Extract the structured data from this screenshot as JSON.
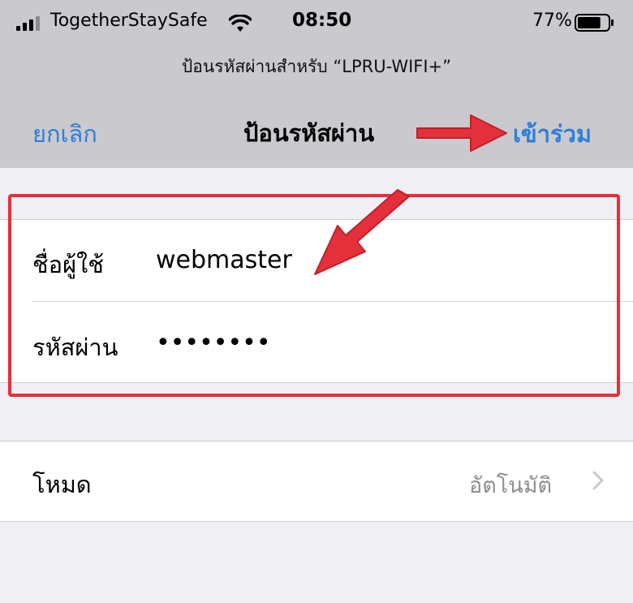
{
  "status_bar": {
    "carrier": "TogetherStaySafe",
    "time": "08:50",
    "battery_percent": "77%",
    "battery_level": 0.77,
    "signal_icon": "signal-bars-icon",
    "wifi_icon": "wifi-icon",
    "battery_icon": "battery-icon"
  },
  "dialog": {
    "prompt": "ป้อนรหัสผ่านสำหรับ “LPRU-WIFI+”",
    "cancel_label": "ยกเลิก",
    "title": "ป้อนรหัสผ่าน",
    "join_label": "เข้าร่วม"
  },
  "form": {
    "username_label": "ชื่อผู้ใช้",
    "username_value": "webmaster",
    "password_label": "รหัสผ่าน",
    "password_value": "••••••••"
  },
  "mode": {
    "label": "โหมด",
    "value": "อัตโนมัติ",
    "chevron_icon": "chevron-right-icon"
  },
  "colors": {
    "accent": "#2d7ed9",
    "header_bg": "#c9c9ce",
    "page_bg": "#efeff4",
    "annotation_red": "#e3303a"
  }
}
